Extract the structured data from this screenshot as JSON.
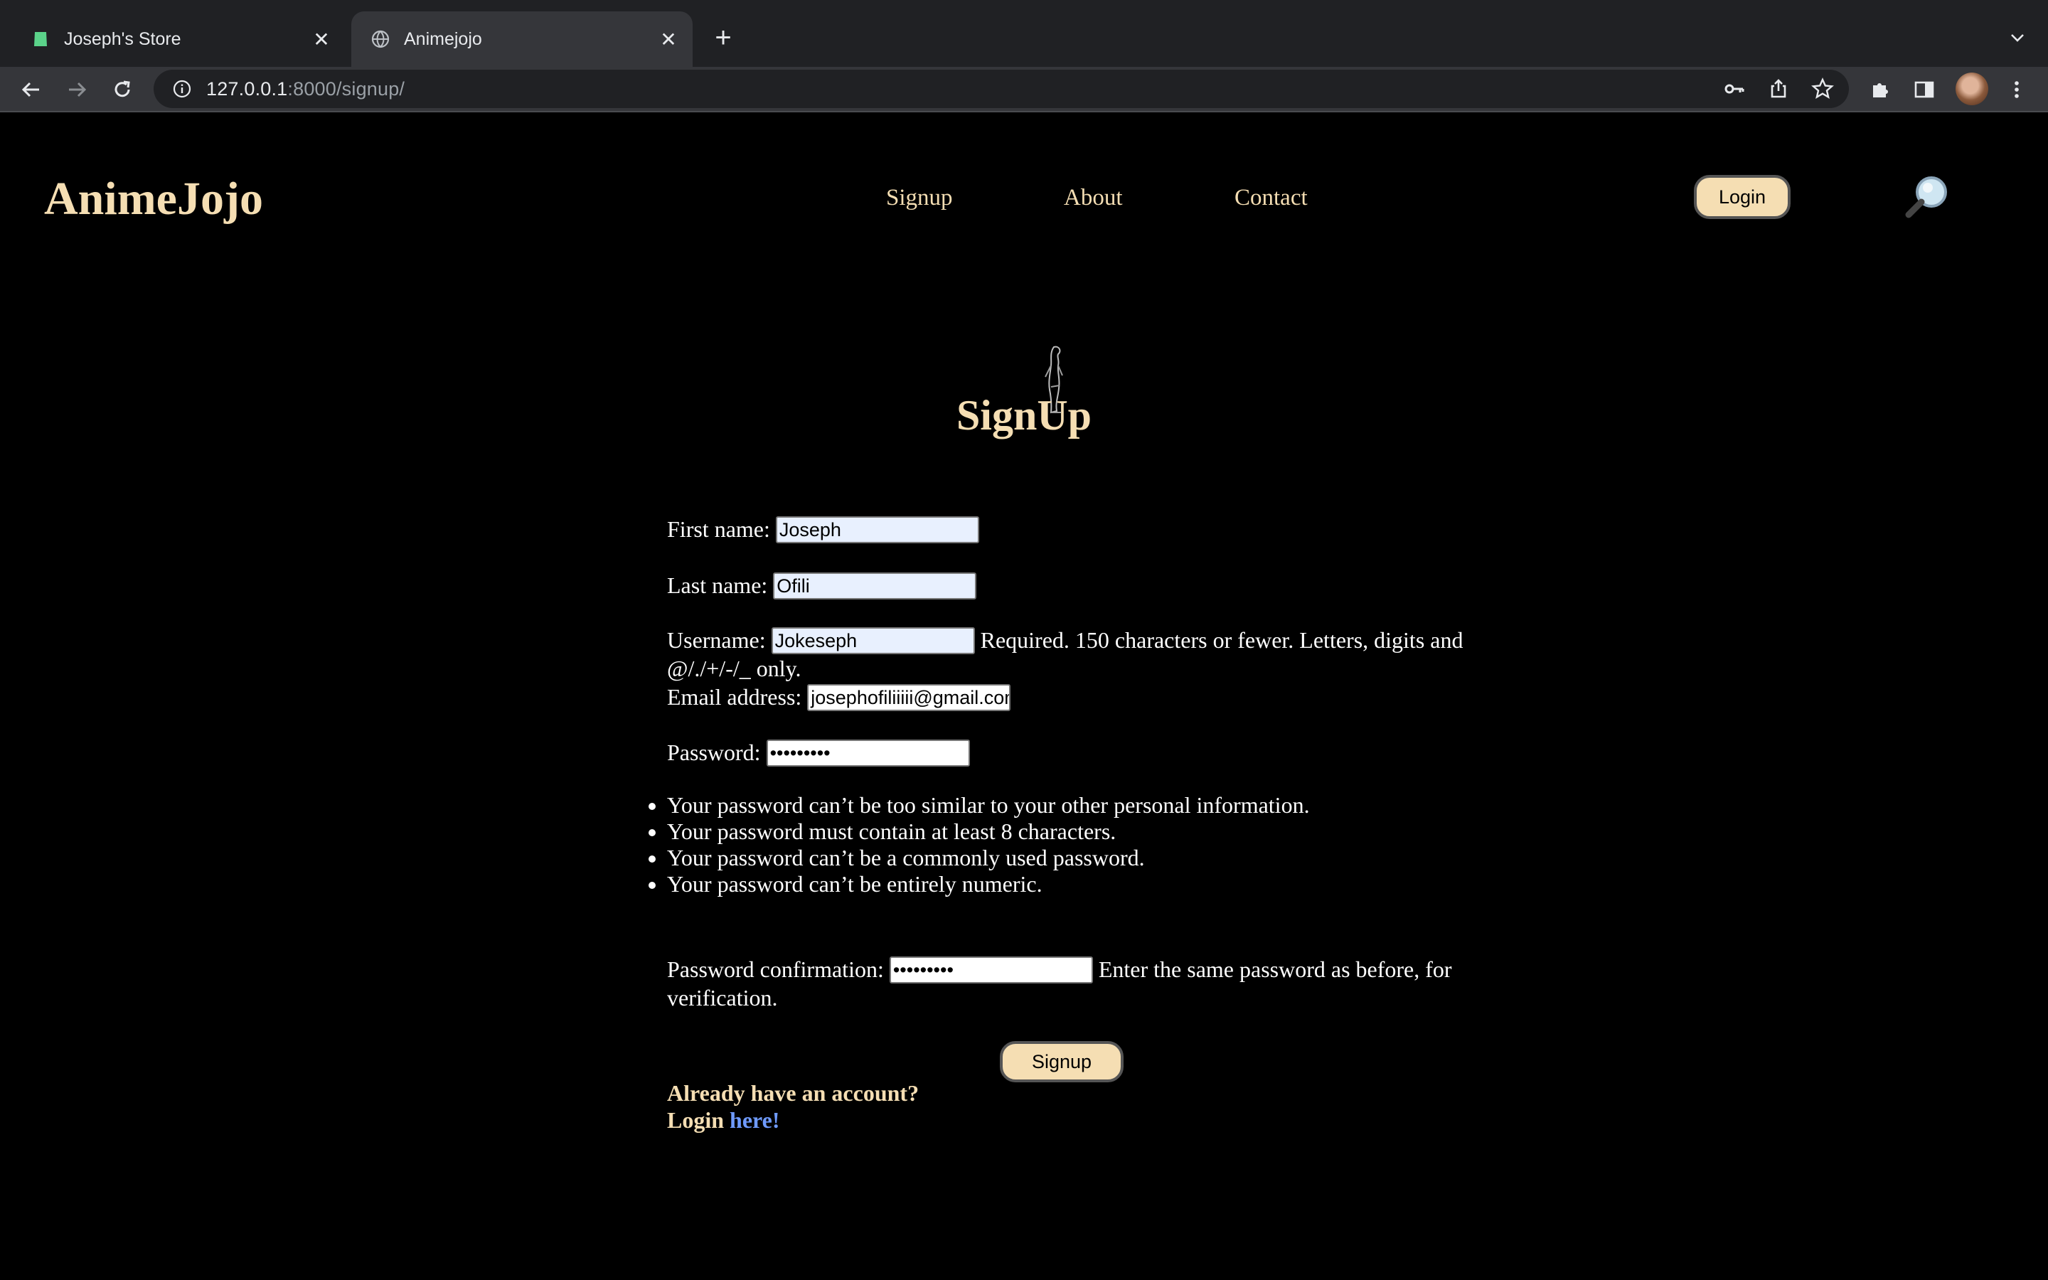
{
  "browser": {
    "tabs": [
      {
        "title": "Joseph's Store",
        "active": false
      },
      {
        "title": "Animejojo",
        "active": true
      }
    ],
    "url_host": "127.0.0.1",
    "url_rest": ":8000/signup/"
  },
  "site": {
    "logo": "AnimeJojo",
    "nav": [
      "Signup",
      "About",
      "Contact"
    ],
    "login_label": "Login"
  },
  "form": {
    "heading": "SignUp",
    "first_name_label": "First name:",
    "first_name_value": "Joseph",
    "last_name_label": "Last name:",
    "last_name_value": "Ofili",
    "username_label": "Username:",
    "username_value": "Jokeseph",
    "username_help": "Required. 150 characters or fewer. Letters, digits and @/./+/-/_ only.",
    "email_label": "Email address:",
    "email_value": "josephofiliiiii@gmail.com",
    "password_label": "Password:",
    "password_value": "•••••••••",
    "password_rules": [
      "Your password can’t be too similar to your other personal information.",
      "Your password must contain at least 8 characters.",
      "Your password can’t be a commonly used password.",
      "Your password can’t be entirely numeric."
    ],
    "confirm_label": "Password confirmation:",
    "confirm_value": "•••••••••",
    "confirm_help": "Enter the same password as before, for verification.",
    "submit_label": "Signup",
    "already_text": "Already have an account?",
    "login_prefix": "Login",
    "login_link": "here!"
  }
}
